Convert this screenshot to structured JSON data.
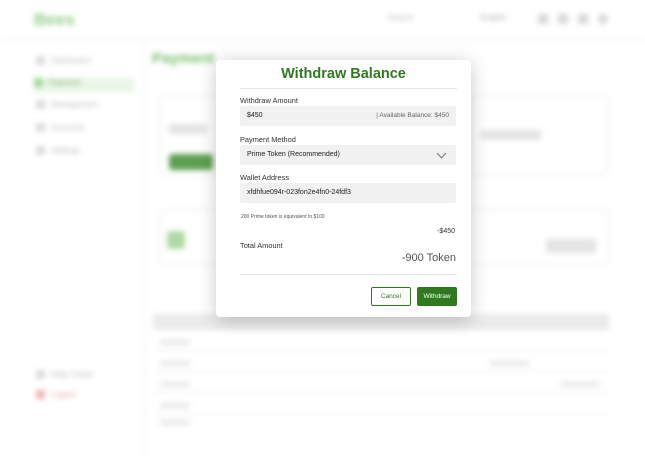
{
  "background": {
    "logo": "Bees",
    "search_placeholder": "Search",
    "select_value": "English",
    "page_title": "Payment",
    "sidebar_items": [
      "Dashboard",
      "Payment",
      "Management",
      "Accounts",
      "Settings"
    ],
    "sidebar_bottom": [
      "Help Center",
      "Logout"
    ]
  },
  "modal": {
    "title": "Withdraw Balance",
    "withdraw_amount_label": "Withdraw Amount",
    "withdraw_amount_value": "$450",
    "available_balance": "| Available Balance: $450",
    "payment_method_label": "Payment Method",
    "payment_method_value": "Prime Token (Recommended)",
    "wallet_address_label": "Wallet Address",
    "wallet_address_value": "xfdhfue094r-023fon2e4fn0-24fdf3",
    "conversion_note": "200 Prime token is equivalent to $100",
    "deducted_amount": "-$450",
    "total_amount_label": "Total Amount",
    "total_amount_value": "-900 Token",
    "cancel_label": "Cancel",
    "withdraw_label": "Withdraw"
  },
  "colors": {
    "brand_green": "#2f7a1f",
    "field_bg": "#f1f1f1"
  }
}
